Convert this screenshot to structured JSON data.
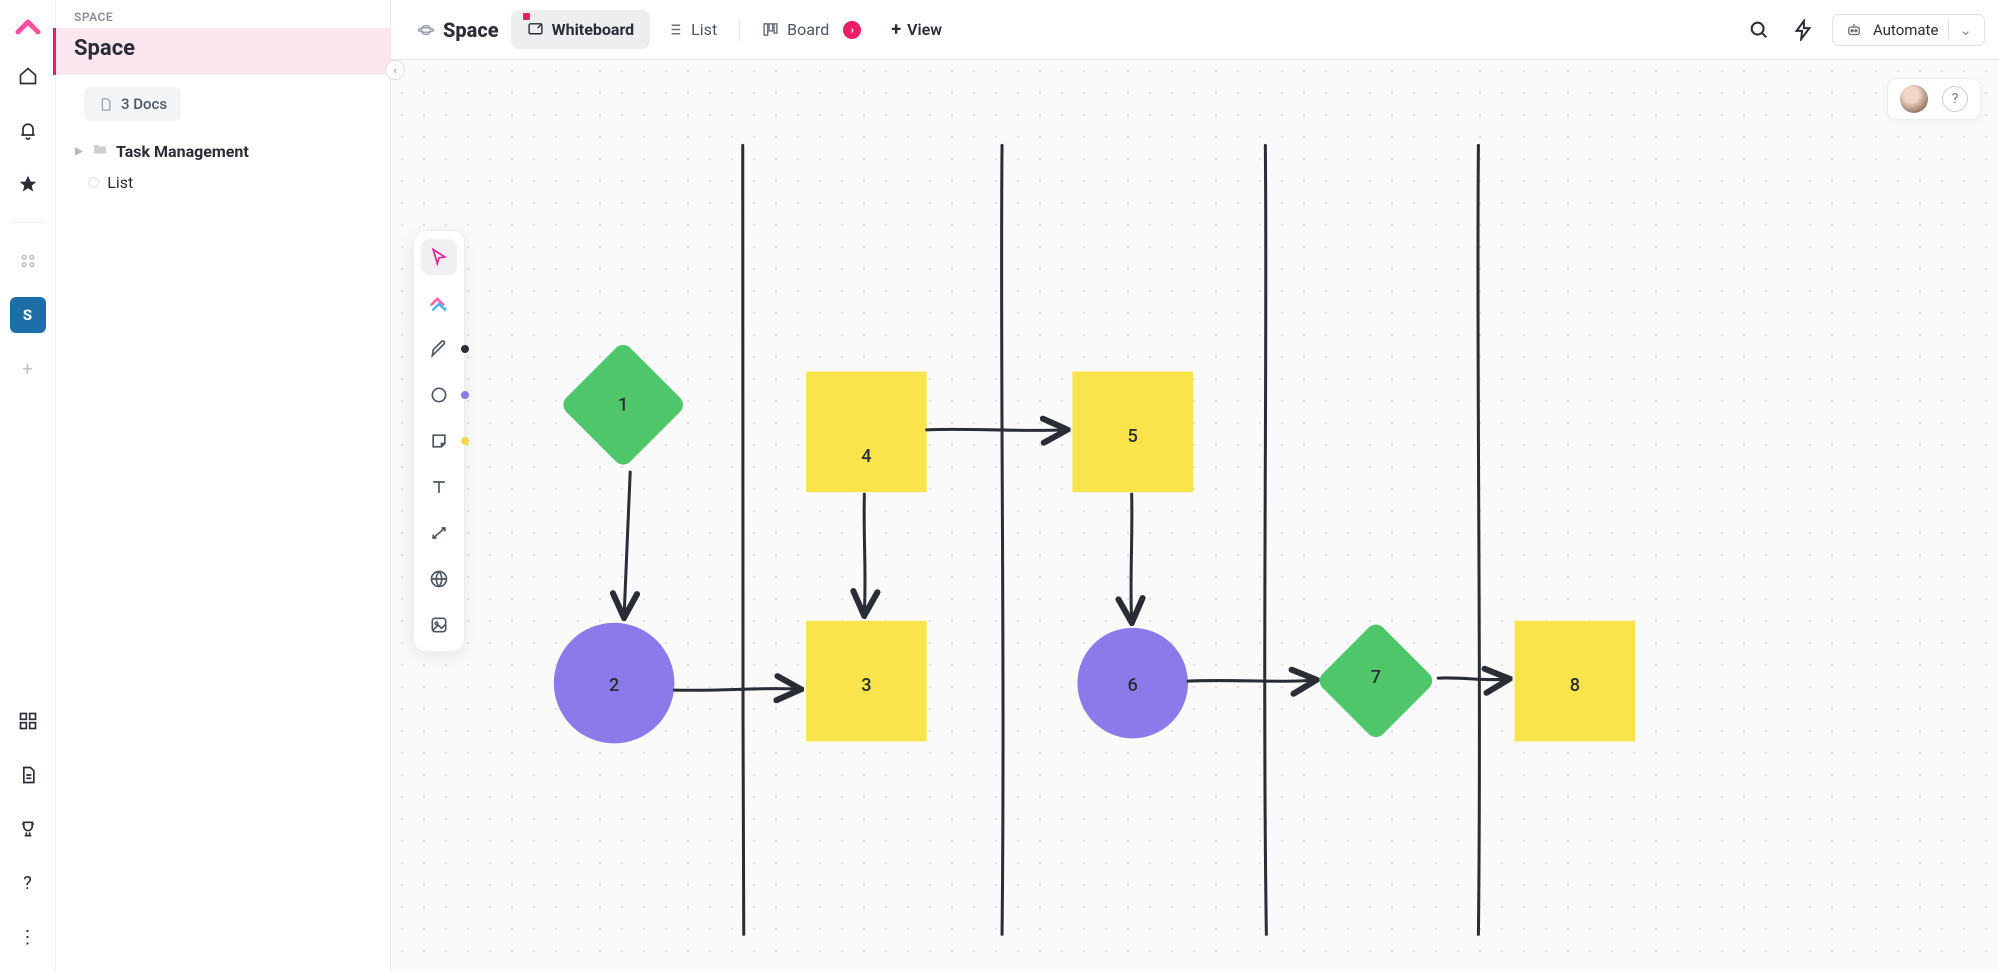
{
  "sidebar": {
    "space_label": "SPACE",
    "space_title": "Space",
    "docs_label": "3 Docs",
    "tree": [
      {
        "label": "Task Management",
        "children": []
      },
      {
        "label": "List",
        "children": []
      }
    ],
    "space_initial": "S"
  },
  "topbar": {
    "crumb": "Space",
    "tabs": {
      "whiteboard": "Whiteboard",
      "list": "List",
      "board": "Board"
    },
    "add_view": "View",
    "automate": "Automate"
  },
  "palette": {
    "pen_swatch": "#2a2e34",
    "shape_swatch": "#8a7aea",
    "sticky_swatch": "#f3d94a"
  },
  "canvas": {
    "shapes": {
      "n1": {
        "label": "1",
        "fill": "#4fc66a"
      },
      "n2": {
        "label": "2",
        "fill": "#8a7aea"
      },
      "n3": {
        "label": "3",
        "fill": "#f9e44c"
      },
      "n4": {
        "label": "4",
        "fill": "#f9e44c"
      },
      "n5": {
        "label": "5",
        "fill": "#f9e44c"
      },
      "n6": {
        "label": "6",
        "fill": "#8a7aea"
      },
      "n7": {
        "label": "7",
        "fill": "#4fc66a"
      },
      "n8": {
        "label": "8",
        "fill": "#f9e44c"
      }
    }
  }
}
